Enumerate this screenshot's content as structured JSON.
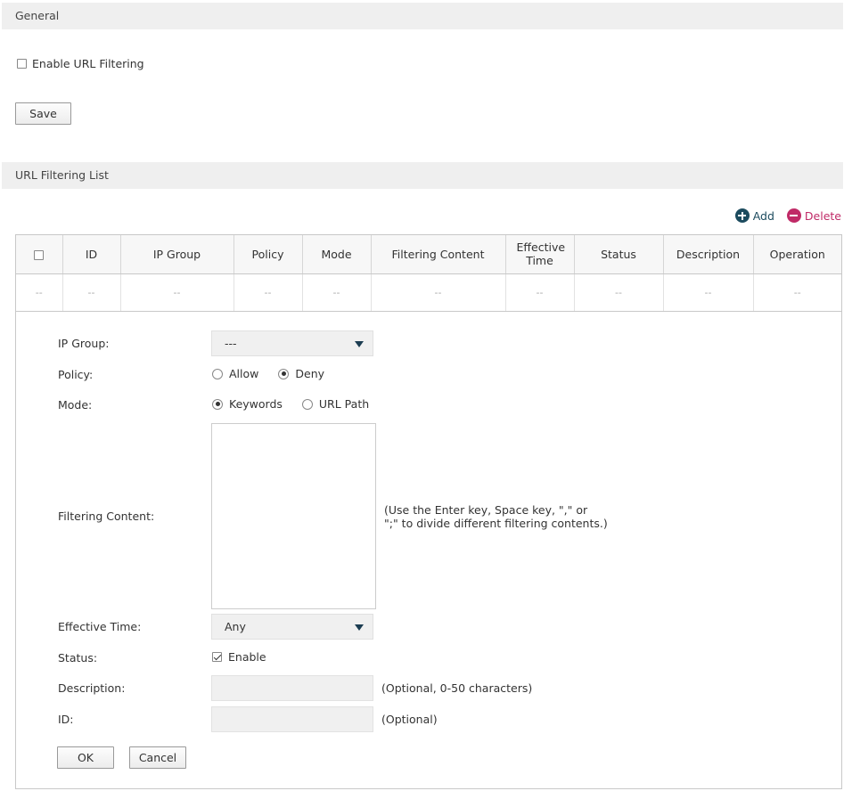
{
  "general": {
    "section_title": "General",
    "enable_url_filtering_label": "Enable URL Filtering",
    "enable_url_filtering_checked": false,
    "save_label": "Save"
  },
  "list": {
    "section_title": "URL Filtering List",
    "add_label": "Add",
    "delete_label": "Delete",
    "columns": [
      "",
      "ID",
      "IP Group",
      "Policy",
      "Mode",
      "Filtering Content",
      "Effective Time",
      "Status",
      "Description",
      "Operation"
    ],
    "rows": [
      [
        "--",
        "--",
        "--",
        "--",
        "--",
        "--",
        "--",
        "--",
        "--",
        "--"
      ]
    ]
  },
  "form": {
    "ip_group_label": "IP Group:",
    "ip_group_value": "---",
    "policy_label": "Policy:",
    "policy_options": [
      "Allow",
      "Deny"
    ],
    "policy_selected": "Deny",
    "mode_label": "Mode:",
    "mode_options": [
      "Keywords",
      "URL Path"
    ],
    "mode_selected": "Keywords",
    "filtering_content_label": "Filtering Content:",
    "filtering_content_value": "",
    "filtering_content_hint_1": "(Use the Enter key, Space key, \",\" or",
    "filtering_content_hint_2": "\";\" to divide different filtering contents.)",
    "effective_time_label": "Effective Time:",
    "effective_time_value": "Any",
    "status_label": "Status:",
    "status_enable_label": "Enable",
    "status_enabled": true,
    "description_label": "Description:",
    "description_value": "",
    "description_hint": "(Optional, 0-50 characters)",
    "id_label": "ID:",
    "id_value": "",
    "id_hint": "(Optional)",
    "ok_label": "OK",
    "cancel_label": "Cancel"
  },
  "colors": {
    "accent": "#1c4b5e",
    "delete": "#c02a67",
    "section_bg": "#efefef"
  }
}
